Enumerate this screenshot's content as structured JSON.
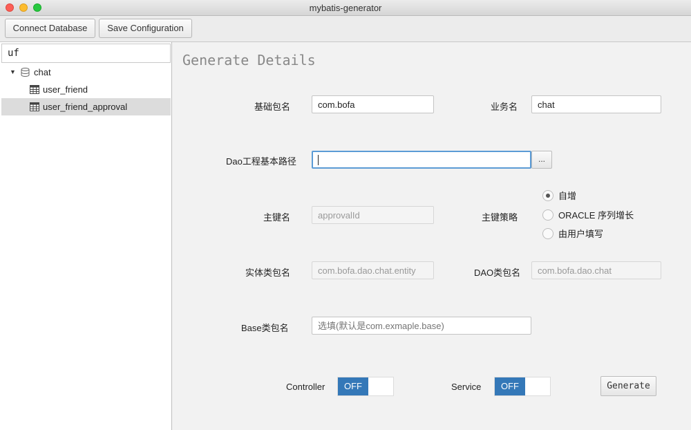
{
  "window": {
    "title": "mybatis-generator"
  },
  "toolbar": {
    "connect_label": "Connect Database",
    "save_label": "Save Configuration"
  },
  "sidebar": {
    "filter_value": "uf",
    "tree": {
      "database": "chat",
      "tables": [
        "user_friend",
        "user_friend_approval"
      ],
      "selected": "user_friend_approval"
    }
  },
  "form": {
    "heading": "Generate Details",
    "base_package": {
      "label": "基础包名",
      "value": "com.bofa"
    },
    "business_name": {
      "label": "业务名",
      "value": "chat"
    },
    "dao_path": {
      "label": "Dao工程基本路径",
      "value": "",
      "browse_label": "..."
    },
    "primary_key": {
      "label": "主键名",
      "value": "approvalId"
    },
    "key_strategy": {
      "label": "主键策略",
      "options": [
        "自增",
        "ORACLE 序列增长",
        "由用户填写"
      ],
      "selected": "自增"
    },
    "entity_package": {
      "label": "实体类包名",
      "value": "com.bofa.dao.chat.entity"
    },
    "dao_package": {
      "label": "DAO类包名",
      "value": "com.bofa.dao.chat"
    },
    "base_class_package": {
      "label": "Base类包名",
      "placeholder": "选填(默认是com.exmaple.base)"
    },
    "controller": {
      "label": "Controller",
      "state": "OFF"
    },
    "service": {
      "label": "Service",
      "state": "OFF"
    },
    "generate_label": "Generate"
  },
  "colors": {
    "toggle_accent": "#3478b8",
    "focus_ring": "#5b9bd5",
    "selection": "#dcdcdc"
  }
}
